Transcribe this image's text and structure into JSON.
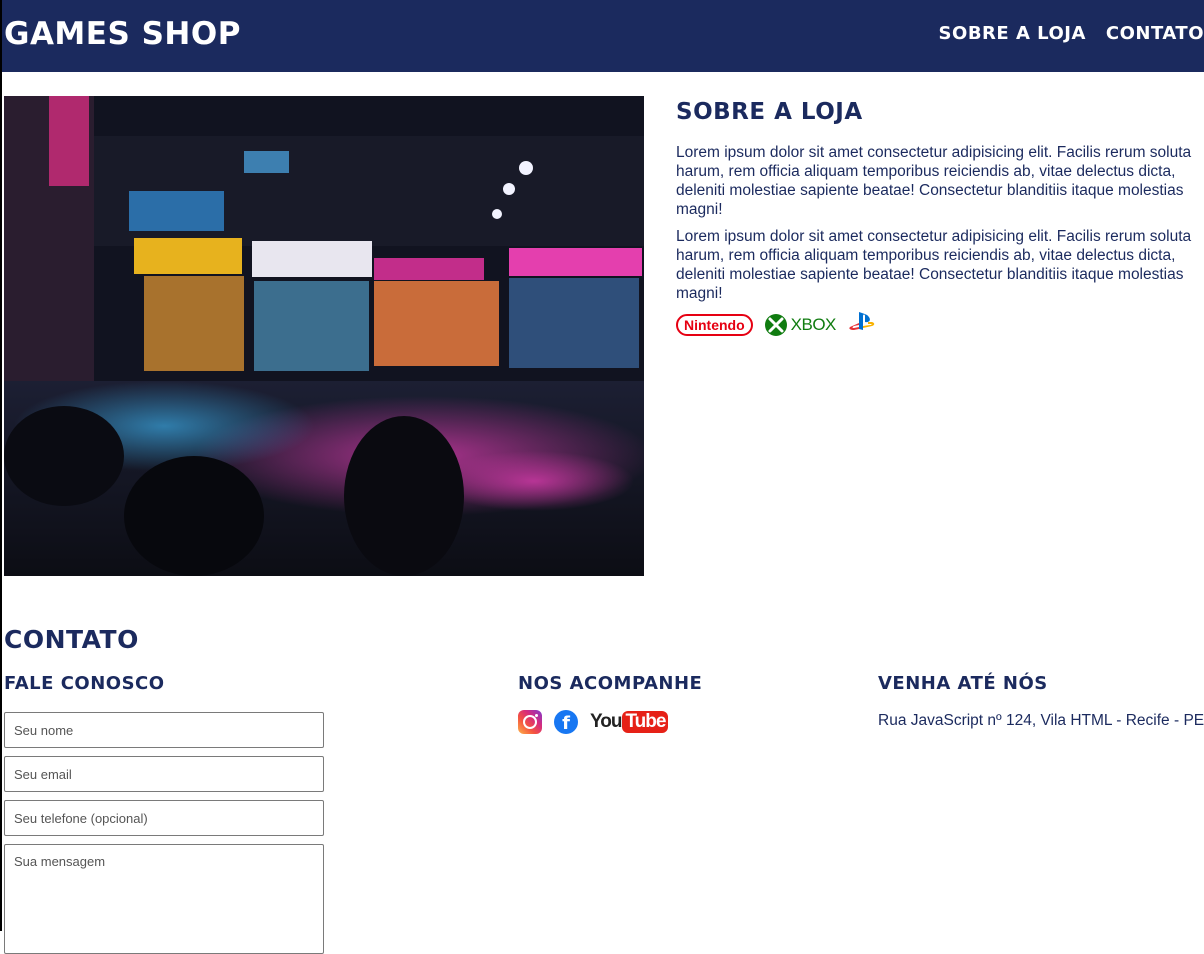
{
  "header": {
    "brand": "GAMES SHOP",
    "nav": [
      {
        "label": "SOBRE A LOJA"
      },
      {
        "label": "CONTATO"
      }
    ]
  },
  "about": {
    "title": "SOBRE A LOJA",
    "paragraphs": [
      "Lorem ipsum dolor sit amet consectetur adipisicing elit. Facilis rerum soluta harum, rem officia aliquam temporibus reiciendis ab, vitae delectus dicta, deleniti molestiae sapiente beatae! Consectetur blanditiis itaque molestias magni!",
      "Lorem ipsum dolor sit amet consectetur adipisicing elit. Facilis rerum soluta harum, rem officia aliquam temporibus reiciendis ab, vitae delectus dicta, deleniti molestiae sapiente beatae! Consectetur blanditiis itaque molestias magni!"
    ],
    "brands": {
      "nintendo": "Nintendo",
      "xbox": "XBOX"
    },
    "image_icon": "night-street-photo"
  },
  "contact": {
    "title": "CONTATO",
    "form": {
      "title": "FALE CONOSCO",
      "name_placeholder": "Seu nome",
      "email_placeholder": "Seu email",
      "phone_placeholder": "Seu telefone (opcional)",
      "message_placeholder": "Sua mensagem"
    },
    "social": {
      "title": "NOS ACOMPANHE",
      "youtube_you": "You",
      "youtube_tube": "Tube"
    },
    "location": {
      "title": "VENHA ATÉ NÓS",
      "address": "Rua JavaScript nº 124, Vila HTML - Recife - PE"
    }
  },
  "colors": {
    "primary": "#1b2a5e",
    "white": "#ffffff"
  }
}
